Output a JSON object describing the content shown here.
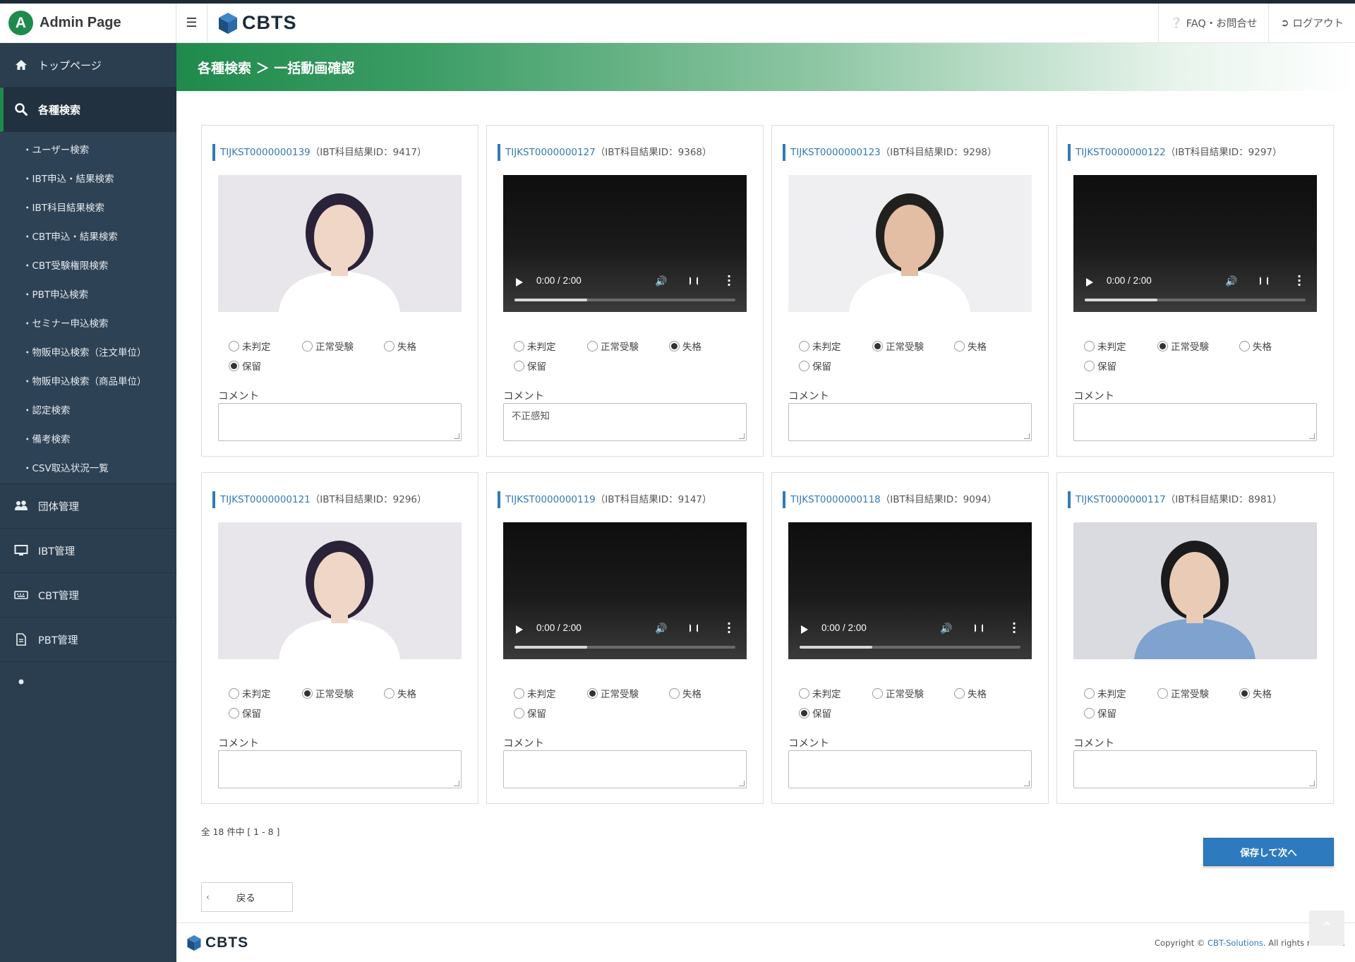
{
  "app": {
    "name": "Admin Page",
    "logo_letter": "A",
    "brand": "CBTS"
  },
  "header": {
    "menu_icon": "hamburger-icon",
    "faq_label": "FAQ・お問合せ",
    "logout_label": "ログアウト"
  },
  "breadcrumb": {
    "text": "各種検索 ＞ 一括動画確認"
  },
  "sidebar": {
    "top": "トップページ",
    "search": "各種検索",
    "sub_items": [
      "・ユーザー検索",
      "・IBT申込・結果検索",
      "・IBT科目結果検索",
      "・CBT申込・結果検索",
      "・CBT受験権限検索",
      "・PBT申込検索",
      "・セミナー申込検索",
      "・物販申込検索（注文単位）",
      "・物販申込検索（商品単位）",
      "・認定検索",
      "・備考検索",
      "・CSV取込状況一覧"
    ],
    "groups": [
      "団体管理",
      "IBT管理",
      "CBT管理",
      "PBT管理"
    ]
  },
  "radio_labels": {
    "undecided": "未判定",
    "normal": "正常受験",
    "disqualified": "失格",
    "hold": "保留"
  },
  "comment_label": "コメント",
  "cards": [
    {
      "id": "TIJKST0000000139",
      "result_id": "（IBT科目結果ID：9417）",
      "media": "photo",
      "selected": "hold",
      "comment": ""
    },
    {
      "id": "TIJKST0000000127",
      "result_id": "（IBT科目結果ID：9368）",
      "media": "video",
      "time": "0:00 / 2:00",
      "progress": 0.33,
      "selected": "disqualified",
      "comment": "不正感知"
    },
    {
      "id": "TIJKST0000000123",
      "result_id": "（IBT科目結果ID：9298）",
      "media": "photo",
      "selected": "normal",
      "comment": ""
    },
    {
      "id": "TIJKST0000000122",
      "result_id": "（IBT科目結果ID：9297）",
      "media": "video",
      "time": "0:00 / 2:00",
      "progress": 0.33,
      "selected": "normal",
      "comment": ""
    },
    {
      "id": "TIJKST0000000121",
      "result_id": "（IBT科目結果ID：9296）",
      "media": "photo",
      "selected": "normal",
      "comment": ""
    },
    {
      "id": "TIJKST0000000119",
      "result_id": "（IBT科目結果ID：9147）",
      "media": "video",
      "time": "0:00 / 2:00",
      "progress": 0.33,
      "selected": "normal",
      "comment": ""
    },
    {
      "id": "TIJKST0000000118",
      "result_id": "（IBT科目結果ID：9094）",
      "media": "video",
      "time": "0:00 / 2:00",
      "progress": 0.33,
      "selected": "hold",
      "comment": ""
    },
    {
      "id": "TIJKST0000000117",
      "result_id": "（IBT科目結果ID：8981）",
      "media": "photo",
      "selected": "disqualified",
      "comment": ""
    }
  ],
  "pager": {
    "text": "全 18 件中 [ 1 - 8 ]"
  },
  "buttons": {
    "save_next": "保存して次へ",
    "back": "戻る"
  },
  "footer": {
    "copyright_prefix": "Copyright ©",
    "company": "CBT-Solutions",
    "copyright_suffix": ". All rights reserved."
  },
  "colors": {
    "sidebar": "#2b3e50",
    "accent_green": "#1f8a4c",
    "link_blue": "#337ab7",
    "button_blue": "#2e7abf"
  }
}
